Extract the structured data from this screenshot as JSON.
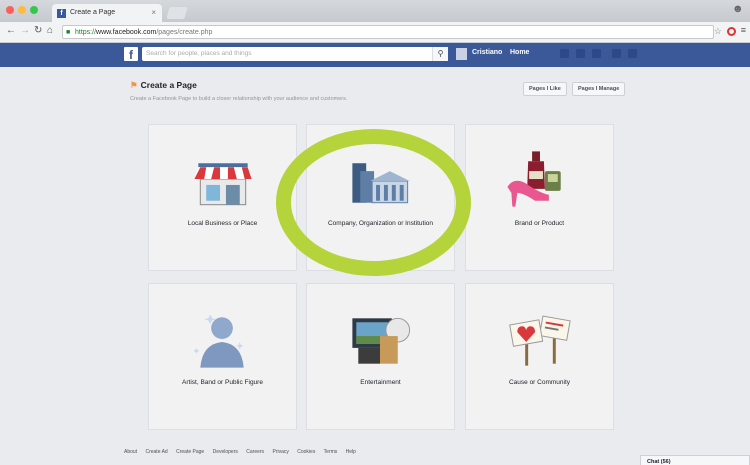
{
  "browser": {
    "tab_title": "Create a Page",
    "tab_close": "×",
    "url_scheme": "https://",
    "url_host": "www.facebook.com",
    "url_path": "/pages/create.php"
  },
  "fbbar": {
    "logo": "f",
    "search_placeholder": "Search for people, places and things",
    "user_name": "Cristiano",
    "home": "Home"
  },
  "page": {
    "title": "Create a Page",
    "subtitle": "Create a Facebook Page to build a closer relationship with your audience and customers.",
    "pages_i_like": "Pages I Like",
    "pages_i_manage": "Pages I Manage"
  },
  "categories": [
    {
      "label": "Local Business or Place",
      "icon": "storefront-icon"
    },
    {
      "label": "Company, Organization or Institution",
      "icon": "buildings-icon"
    },
    {
      "label": "Brand or Product",
      "icon": "products-icon"
    },
    {
      "label": "Artist, Band or Public Figure",
      "icon": "person-silhouette-icon"
    },
    {
      "label": "Entertainment",
      "icon": "tv-icon"
    },
    {
      "label": "Cause or Community",
      "icon": "signs-icon"
    }
  ],
  "highlight_color": "#b3d335",
  "footer": [
    "About",
    "Create Ad",
    "Create Page",
    "Developers",
    "Careers",
    "Privacy",
    "Cookies",
    "Terms",
    "Help"
  ],
  "chat": "Chat (56)"
}
